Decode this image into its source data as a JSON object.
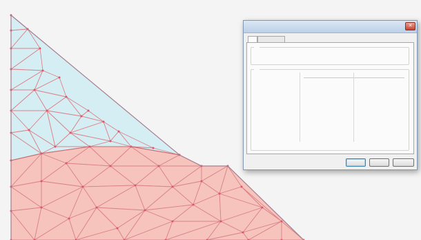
{
  "window": {
    "title": "",
    "close_glyph": "✕",
    "tabs": [
      {
        "label": "",
        "active": true
      },
      {
        "label": "",
        "active": false
      }
    ],
    "top_group": {
      "legend": "",
      "rows": [
        {
          "label": "",
          "value": "",
          "label2": "",
          "value2": ""
        },
        {
          "label": "",
          "value": "",
          "label2": "",
          "value2": ""
        }
      ]
    },
    "properties_group": {
      "legend": "",
      "column_headers": [
        "",
        ""
      ],
      "rows": [
        {
          "label": "",
          "c1": "",
          "v1": "",
          "c2": "",
          "v2": ""
        },
        {
          "label": "",
          "c1": "",
          "v1": "",
          "c2": "",
          "v2": ""
        },
        {
          "label": "",
          "c1": "",
          "v1": "",
          "c2": "",
          "v2": ""
        },
        {
          "label": "",
          "c1": "",
          "v1": "",
          "c2": "",
          "v2": ""
        },
        {
          "label": "",
          "c1": "",
          "v1": "",
          "c2": "",
          "v2": ""
        },
        {
          "label": "",
          "c1": "",
          "v1": "",
          "c2": "",
          "v2": ""
        },
        {
          "label": "",
          "c1": "",
          "v1": "",
          "c2": "",
          "v2": ""
        },
        {
          "label": "",
          "c1": "",
          "v1": "",
          "c2": "",
          "v2": ""
        }
      ]
    },
    "buttons": [
      {
        "label": ""
      },
      {
        "label": ""
      },
      {
        "label": ""
      }
    ]
  },
  "colors": {
    "upper_material_fill": "#d4eef3",
    "lower_material_fill": "#f6c4bd",
    "mesh_edge": "#d9848a",
    "node": "#e0556a",
    "boundary": "#a67d8e",
    "value_text": "#2b2bd0"
  }
}
